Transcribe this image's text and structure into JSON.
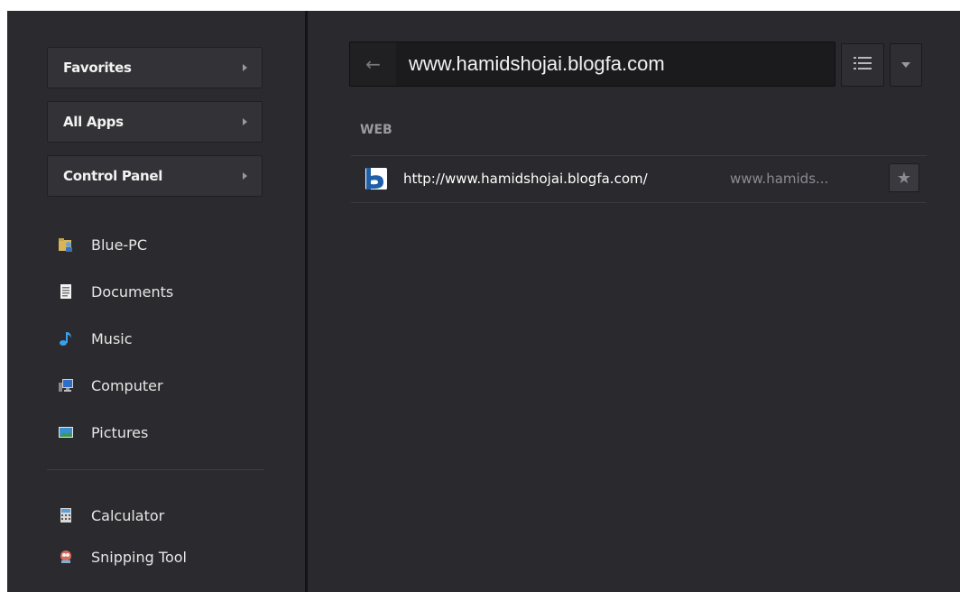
{
  "menu": {
    "categories": [
      {
        "label": "Favorites"
      },
      {
        "label": "All Apps"
      },
      {
        "label": "Control Panel"
      }
    ],
    "places": [
      {
        "label": "Blue-PC",
        "icon": "user-folder-icon"
      },
      {
        "label": "Documents",
        "icon": "documents-icon"
      },
      {
        "label": "Music",
        "icon": "music-note-icon"
      },
      {
        "label": "Computer",
        "icon": "computer-icon"
      },
      {
        "label": "Pictures",
        "icon": "pictures-icon"
      }
    ],
    "apps": [
      {
        "label": "Calculator",
        "icon": "calculator-icon"
      },
      {
        "label": "Snipping Tool",
        "icon": "snipping-tool-icon"
      }
    ]
  },
  "search": {
    "back_glyph": "←",
    "value": "www.hamidshojai.blogfa.com"
  },
  "results": {
    "section_label": "WEB",
    "items": [
      {
        "url": "http://www.hamidshojai.blogfa.com/",
        "host": "www.hamids...",
        "icon": "blogfa-icon"
      }
    ]
  },
  "colors": {
    "background": "#2a2a2e",
    "search_bg": "#1b1b1d",
    "accent_blue": "#1f5fa8"
  }
}
